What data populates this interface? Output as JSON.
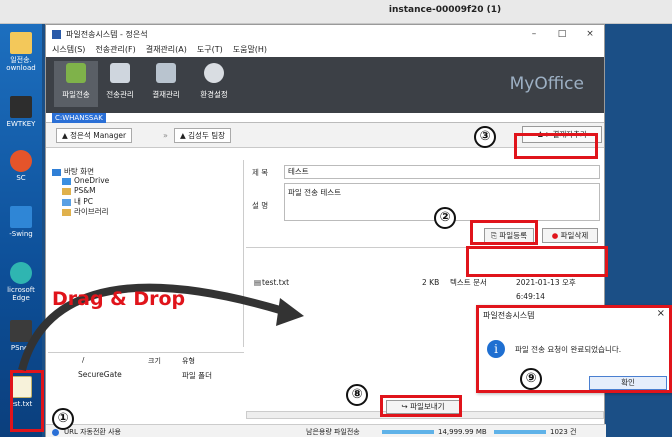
{
  "vm": {
    "title": "instance-00009f20 (1)"
  },
  "desktop": {
    "icons": [
      {
        "label": "일전송.",
        "label2": "ownload"
      },
      {
        "label": "TKEY",
        "label2": "EWTKEY"
      },
      {
        "label": "SC",
        "label2": "SC"
      },
      {
        "label": "Swing",
        "label2": "-Swing"
      },
      {
        "label": "licrosoft",
        "label2": "Edge"
      },
      {
        "label": "PSnet",
        "label2": "PSnet"
      },
      {
        "label": "est.txt",
        "label2": ""
      }
    ]
  },
  "app": {
    "title": "파일전송시스템 - 정은석",
    "window_buttons": {
      "minimize": "–",
      "maximize": "□",
      "close": "×"
    },
    "menu": [
      "시스템(S)",
      "전송관리(F)",
      "결재관리(A)",
      "도구(T)",
      "도움말(H)"
    ],
    "toolbar": [
      "파일전송",
      "전송관리",
      "결재관리",
      "환경설정"
    ],
    "brand": "MyOffice",
    "user_strip": "C:WHANSSAK",
    "recipients": {
      "sender": "정은석 Manager",
      "approver": "김성두 팀장",
      "sep": "»"
    },
    "approver_add": "결재자추가",
    "tree": {
      "root": "바탕 화면",
      "items": [
        "OneDrive",
        "PS&M",
        "내 PC",
        "라이브러리"
      ]
    },
    "form": {
      "title_label": "제 목",
      "title_value": "테스트",
      "desc_label": "설 명",
      "desc_value": "파일 전송 테스트",
      "register_btn": "파일등록",
      "delete_btn": "파일삭제"
    },
    "file": {
      "name": "test.txt",
      "size": "2 KB",
      "type": "텍스트 문서",
      "date": "2021-01-13 오후 6:49:14"
    },
    "local_list": {
      "headers": [
        "/",
        "크기",
        "유형"
      ],
      "row": {
        "name": "SecureGate",
        "type": "파일 폴더"
      }
    },
    "send_btn": "파일보내기",
    "status": {
      "left": "URL 자동전환 사용",
      "middle": "남은용량 파일전송",
      "size": "14,999.99 MB",
      "count": "1023 건"
    }
  },
  "dialog": {
    "title": "파일전송시스템",
    "close": "×",
    "icon": "i",
    "message": "파일 전송 요청이 완료되었습니다.",
    "ok": "확인"
  },
  "annotations": {
    "drag": "Drag & Drop",
    "steps": [
      "①",
      "②",
      "③",
      "⑧",
      "⑨"
    ]
  }
}
